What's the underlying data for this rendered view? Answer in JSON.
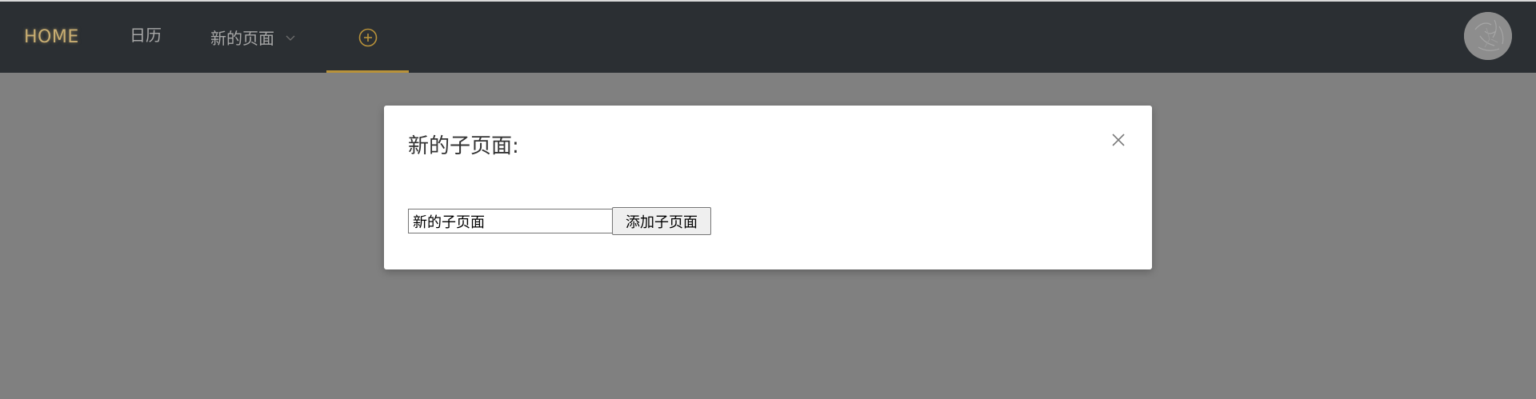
{
  "nav": {
    "home_label": "HOME",
    "calendar_label": "日历",
    "newpage_label": "新的页面",
    "add_icon": "plus-circle-icon",
    "dropdown_icon": "chevron-down-icon",
    "avatar_icon": "user-avatar"
  },
  "colors": {
    "topbar_bg": "#2b2f33",
    "accent_gold": "#c9ae72",
    "active_underline": "#b8923a",
    "overlay": "#808080",
    "nav_text": "#a7a7a7"
  },
  "modal": {
    "title": "新的子页面:",
    "close_icon": "close-icon",
    "input_value": "新的子页面",
    "submit_label": "添加子页面"
  }
}
